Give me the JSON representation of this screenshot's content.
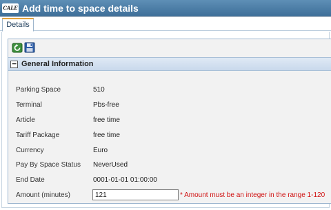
{
  "window": {
    "logo_text": "CALE",
    "title": "Add time to space details"
  },
  "tabs": [
    {
      "label": "Details",
      "active": true
    }
  ],
  "toolbar": {
    "back_icon": "refresh-back-icon",
    "save_icon": "save-floppy-icon"
  },
  "section": {
    "title": "General Information",
    "collapse_glyph": "−"
  },
  "fields": {
    "parking_space": {
      "label": "Parking Space",
      "value": "510"
    },
    "terminal": {
      "label": "Terminal",
      "value": "Pbs-free"
    },
    "article": {
      "label": "Article",
      "value": "free time"
    },
    "tariff_package": {
      "label": "Tariff Package",
      "value": "free time"
    },
    "currency": {
      "label": "Currency",
      "value": "Euro"
    },
    "pay_by_space_status": {
      "label": "Pay By Space Status",
      "value": "NeverUsed"
    },
    "end_date": {
      "label": "End Date",
      "value": "0001-01-01 01:00:00"
    },
    "amount": {
      "label": "Amount (minutes)",
      "value": "121",
      "error": "* Amount must be an integer in the range 1-120"
    }
  },
  "colors": {
    "titlebar": "#4a7ca6",
    "error": "#d01010",
    "tab_accent": "#e2a13b"
  }
}
